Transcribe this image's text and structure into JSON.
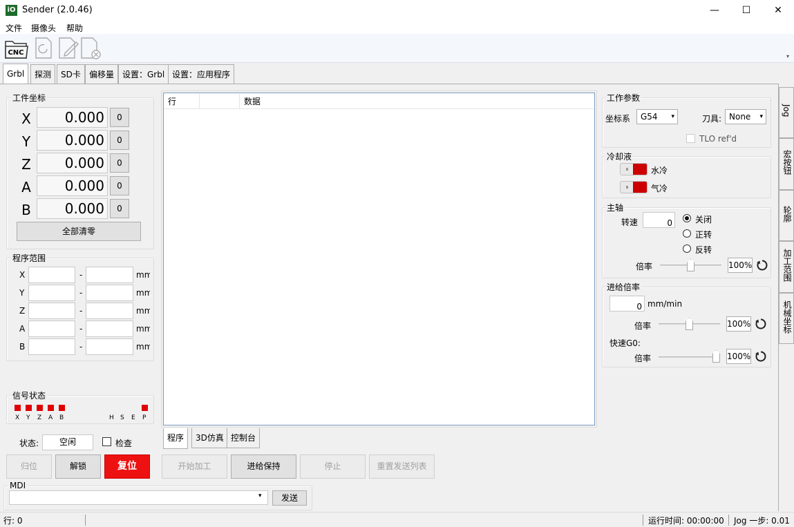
{
  "window": {
    "title": "Sender (2.0.46)",
    "icon_text": "iO",
    "min": "—",
    "max": "☐",
    "close": "✕"
  },
  "menu": [
    "文件",
    "摄像头",
    "帮助"
  ],
  "toolbar": {
    "cnc_label": "CNC"
  },
  "tabs": [
    "Grbl",
    "探测",
    "SD卡",
    "偏移量",
    "设置：Grbl",
    "设置：应用程序"
  ],
  "work_coords": {
    "title": "工件坐标",
    "axes": [
      {
        "axis": "X",
        "value": "0.000",
        "zero": "0"
      },
      {
        "axis": "Y",
        "value": "0.000",
        "zero": "0"
      },
      {
        "axis": "Z",
        "value": "0.000",
        "zero": "0"
      },
      {
        "axis": "A",
        "value": "0.000",
        "zero": "0"
      },
      {
        "axis": "B",
        "value": "0.000",
        "zero": "0"
      }
    ],
    "clear_all": "全部清零"
  },
  "program_range": {
    "title": "程序范围",
    "axes": [
      "X",
      "Y",
      "Z",
      "A",
      "B"
    ],
    "dash": "-",
    "unit": "mm"
  },
  "signal": {
    "title": "信号状态",
    "left_labels": [
      "X",
      "Y",
      "Z",
      "A",
      "B"
    ],
    "right_labels": [
      "H",
      "S",
      "E",
      "P"
    ]
  },
  "state": {
    "label": "状态:",
    "value": "空闲",
    "check_label": "检查"
  },
  "buttons": {
    "home": "归位",
    "unlock": "解锁",
    "reset": "复位",
    "start": "开始加工",
    "hold": "进给保持",
    "stop": "停止",
    "rewind": "重置发送列表",
    "send": "发送"
  },
  "grid": {
    "col_line": "行",
    "col_data": "数据"
  },
  "bottom_tabs": [
    "程序",
    "3D仿真",
    "控制台"
  ],
  "mdi": {
    "label": "MDI"
  },
  "work_params": {
    "title": "工作参数",
    "coord_label": "坐标系",
    "coord_value": "G54",
    "tool_label": "刀具:",
    "tool_value": "None",
    "tlo": "TLO ref'd"
  },
  "coolant": {
    "title": "冷却液",
    "flood": "水冷",
    "mist": "气冷"
  },
  "spindle": {
    "title": "主轴",
    "rpm_label": "转速",
    "rpm_value": "0",
    "off": "关闭",
    "cw": "正转",
    "ccw": "反转",
    "override_label": "倍率",
    "override_value": "100%",
    "override_level": 0.5
  },
  "feed": {
    "title": "进给倍率",
    "value": "0",
    "unit": "mm/min",
    "override_label": "倍率",
    "override_value": "100%",
    "override_level": 0.5,
    "rapid_label": "快速G0:",
    "rapid_override_label": "倍率",
    "rapid_override_value": "100%",
    "rapid_level": 1.0
  },
  "side_tabs": [
    "Jog",
    "宏按钮",
    "轮廓",
    "加工范围",
    "机械坐标"
  ],
  "status": {
    "line": "行: 0",
    "runtime": "运行时间: 00:00:00",
    "jog": "Jog 一步: 0.01"
  }
}
